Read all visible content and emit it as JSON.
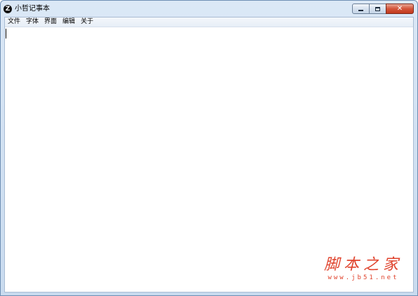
{
  "window": {
    "title": "小哲记事本",
    "icon_letter": "Z",
    "icon": "app-z-icon",
    "buttons": [
      "minimize-icon",
      "maximize-icon",
      "close-icon"
    ],
    "close_glyph": "✕"
  },
  "menubar": {
    "items": [
      {
        "label": "文件"
      },
      {
        "label": "字体"
      },
      {
        "label": "界面"
      },
      {
        "label": "编辑"
      },
      {
        "label": "关于"
      }
    ]
  },
  "editor": {
    "content": ""
  },
  "watermark": {
    "text": "脚本之家",
    "url": "www.jb51.net",
    "color": "#e0442e"
  }
}
